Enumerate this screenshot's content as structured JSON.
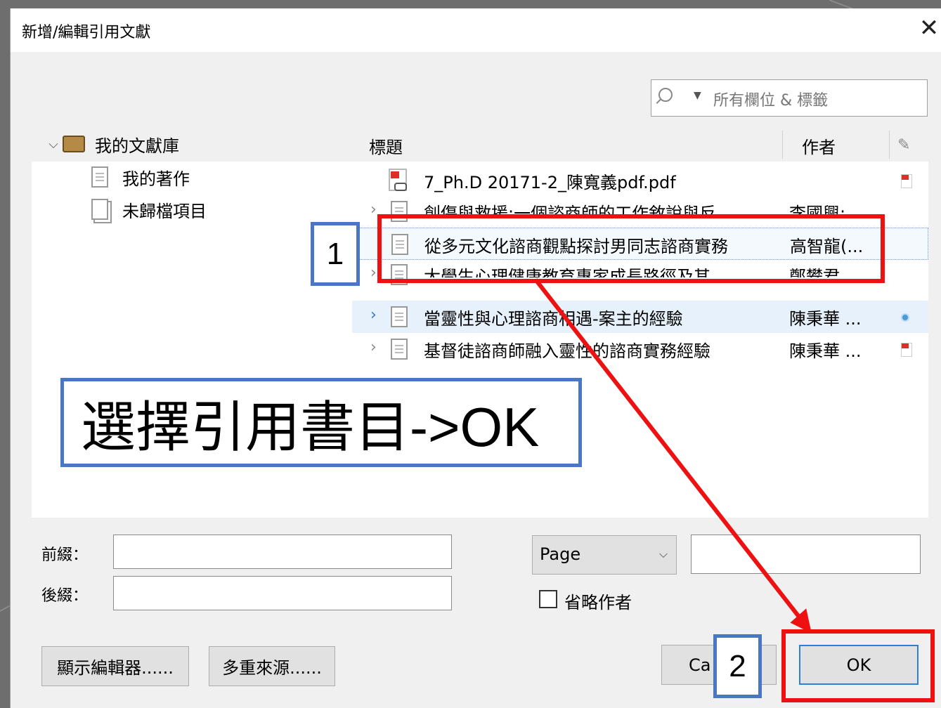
{
  "dialog": {
    "title": "新增/編輯引用文獻",
    "close_label": "✕"
  },
  "search": {
    "dropdown_glyph": "▼",
    "placeholder": "所有欄位 & 標籤"
  },
  "tree": {
    "root_label": "我的文獻庫",
    "items": [
      {
        "label": "我的著作",
        "icon": "document-icon"
      },
      {
        "label": "未歸檔項目",
        "icon": "unfiled-items-icon"
      }
    ]
  },
  "list": {
    "columns": {
      "title": "標題",
      "author": "作者",
      "attachment_icon": "paperclip-icon"
    },
    "rows": [
      {
        "title": "7_Ph.D 20171-2_陳寬義pdf.pdf",
        "author": "",
        "icon": "pdf-icon",
        "attachment": "pdf",
        "expander": false
      },
      {
        "title": "創傷與救援:一個諮商師的工作敘說與反...",
        "author": "李國興;",
        "icon": "document-icon",
        "attachment": "",
        "expander": true
      },
      {
        "title": "從多元文化諮商觀點探討男同志諮商實務",
        "author": "高智龍(...",
        "icon": "document-icon",
        "attachment": "",
        "expander": false,
        "focused": true
      },
      {
        "title": "大學生心理健康教育專家成長路徑及其...",
        "author": "鄭攀君",
        "icon": "document-icon",
        "attachment": "",
        "expander": true
      },
      {
        "title": "當靈性與心理諮商相遇-案主的經驗",
        "author": "陳秉華 ...",
        "icon": "document-icon",
        "attachment": "link",
        "expander": true,
        "selected": true
      },
      {
        "title": "基督徒諮商師融入靈性的諮商實務經驗",
        "author": "陳秉華 ...",
        "icon": "document-icon",
        "attachment": "pdf",
        "expander": true
      }
    ]
  },
  "form": {
    "prefix_label": "前綴：",
    "suffix_label": "後綴：",
    "prefix_value": "",
    "suffix_value": "",
    "locator_select": "Page",
    "locator_value": "",
    "omit_author_label": "省略作者",
    "omit_author_checked": false
  },
  "buttons": {
    "show_editor": "顯示編輯器......",
    "multiple_sources": "多重來源......",
    "cancel": "Ca",
    "ok": "OK"
  },
  "annotations": {
    "step1": "1",
    "step2": "2",
    "callout": "選擇引用書目->OK",
    "colors": {
      "red": "#ee1111",
      "blue": "#4a77c4"
    }
  }
}
